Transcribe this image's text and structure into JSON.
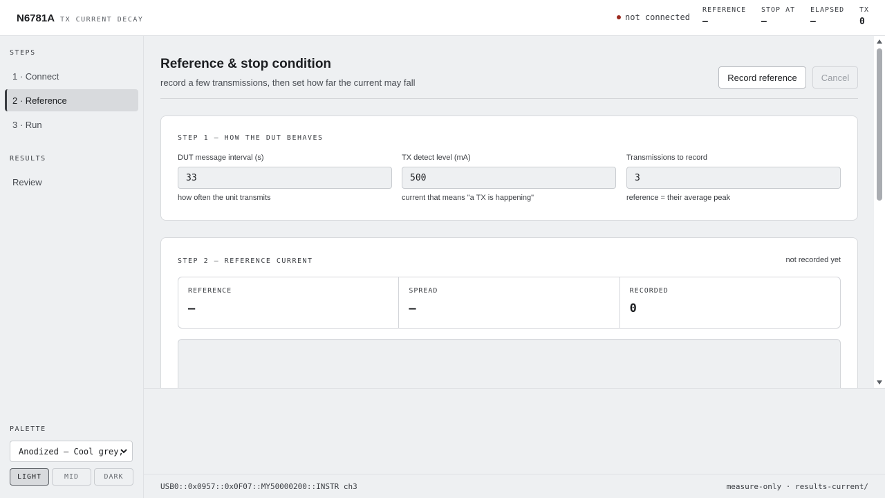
{
  "header": {
    "brand_name": "N6781A",
    "brand_sub": "TX CURRENT DECAY",
    "connection_status": "not connected",
    "connection_color": "#9b2a1f",
    "stats": [
      {
        "label": "REFERENCE",
        "value": "—"
      },
      {
        "label": "STOP AT",
        "value": "—"
      },
      {
        "label": "ELAPSED",
        "value": "—"
      },
      {
        "label": "TX",
        "value": "0"
      }
    ]
  },
  "sidebar": {
    "steps_heading": "STEPS",
    "steps": [
      {
        "label": "1 · Connect"
      },
      {
        "label": "2 · Reference",
        "active": true
      },
      {
        "label": "3 · Run"
      }
    ],
    "results_heading": "RESULTS",
    "results": [
      {
        "label": "Review"
      }
    ],
    "palette_heading": "PALETTE",
    "palette_value": "Anodized — Cool grey, ",
    "themes": [
      {
        "label": "LIGHT",
        "active": true
      },
      {
        "label": "MID"
      },
      {
        "label": "DARK"
      }
    ]
  },
  "main": {
    "title": "Reference & stop condition",
    "subtitle": "record a few transmissions, then set how far the current may fall",
    "record_button": "Record reference",
    "cancel_button": "Cancel",
    "step1": {
      "heading": "STEP 1 — HOW THE DUT BEHAVES",
      "fields": [
        {
          "label": "DUT message interval (s)",
          "value": "33",
          "hint": "how often the unit transmits"
        },
        {
          "label": "TX detect level (mA)",
          "value": "500",
          "hint": "current that means \"a TX is happening\""
        },
        {
          "label": "Transmissions to record",
          "value": "3",
          "hint": "reference = their average peak"
        }
      ]
    },
    "step2": {
      "heading": "STEP 2 — REFERENCE CURRENT",
      "note": "not recorded yet",
      "metrics": [
        {
          "label": "REFERENCE",
          "value": "—"
        },
        {
          "label": "SPREAD",
          "value": "—"
        },
        {
          "label": "RECORDED",
          "value": "0"
        }
      ]
    }
  },
  "statusbar": {
    "left": "USB0::0x0957::0x0F07::MY50000200::INSTR ch3",
    "right": "measure-only · results-current/"
  }
}
